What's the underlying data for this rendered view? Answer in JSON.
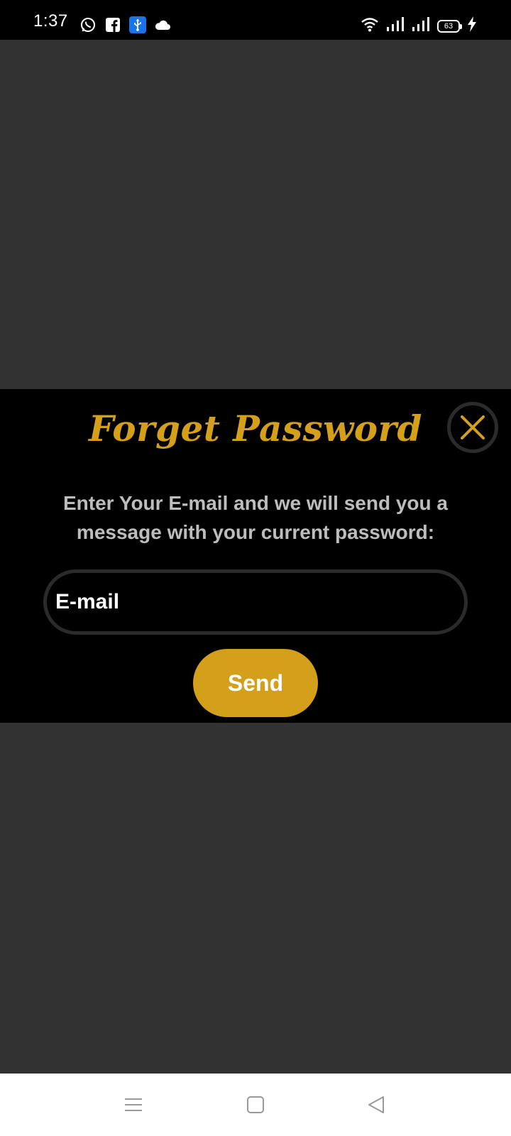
{
  "status_bar": {
    "time": "1:37",
    "battery_level": "63",
    "left_icons": [
      "whatsapp-icon",
      "facebook-icon",
      "usb-icon",
      "cloud-icon"
    ],
    "right_icons": [
      "wifi-icon",
      "signal-icon",
      "signal-icon",
      "battery-icon",
      "charging-icon"
    ]
  },
  "dialog": {
    "title": "Forget Password",
    "message": "Enter Your E-mail and we will send you a message with your current password:",
    "email_placeholder": "E-mail",
    "email_value": "",
    "send_label": "Send",
    "close_icon": "close-icon"
  },
  "nav_bar": {
    "buttons": [
      "menu-icon",
      "home-icon",
      "back-icon"
    ]
  },
  "colors": {
    "accent": "#d4a01b",
    "background": "#323232",
    "dialog_background": "#000000",
    "message_text": "#bdbdbd"
  }
}
